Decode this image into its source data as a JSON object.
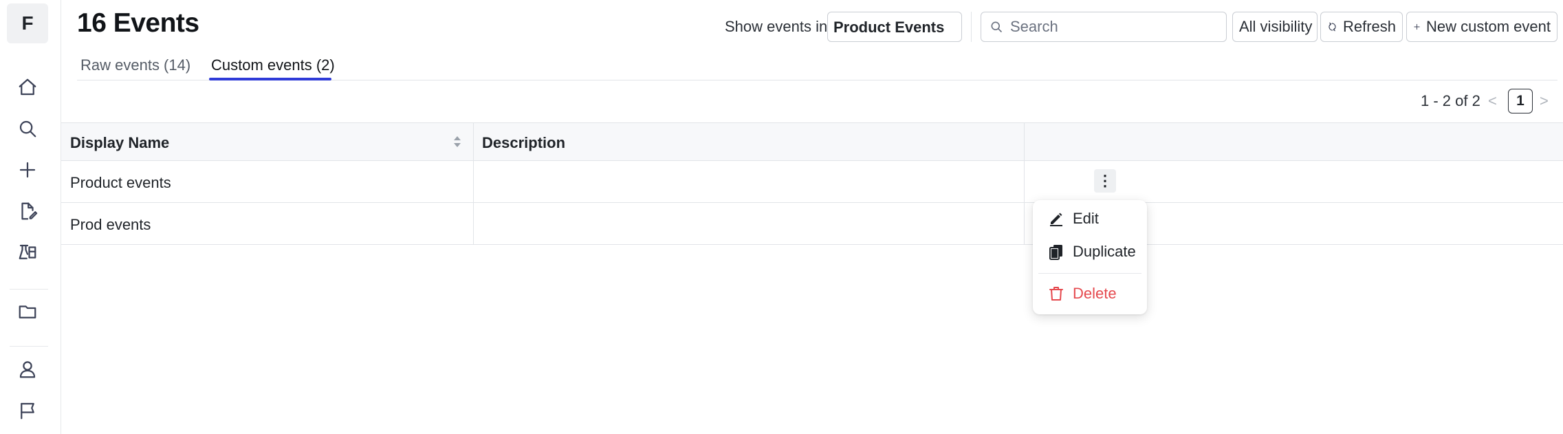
{
  "app": {
    "logo_letter": "F"
  },
  "sidebar": {
    "icons": [
      "home-icon",
      "search-icon",
      "plus-icon",
      "edit-document-icon",
      "lab-flask-icon",
      "folder-icon",
      "user-icon",
      "flag-icon"
    ]
  },
  "header": {
    "title": "16 Events",
    "show_events_label": "Show events in",
    "events_source_value": "Product Events",
    "search_placeholder": "Search",
    "visibility_label": "All visibility",
    "refresh_label": "Refresh",
    "new_event_label": "New custom event"
  },
  "tabs": [
    {
      "label": "Raw events (14)",
      "active": false
    },
    {
      "label": "Custom events (2)",
      "active": true
    }
  ],
  "pagination": {
    "range_text": "1 - 2 of 2",
    "current_page": "1",
    "prev": "<",
    "next": ">"
  },
  "table": {
    "columns": [
      "Display Name",
      "Description",
      ""
    ],
    "rows": [
      {
        "display_name": "Product events",
        "description": ""
      },
      {
        "display_name": "Prod events",
        "description": ""
      }
    ]
  },
  "row_menu": {
    "kebab": "⋮",
    "items": [
      {
        "label": "Edit",
        "icon": "pencil-icon"
      },
      {
        "label": "Duplicate",
        "icon": "duplicate-icon"
      },
      {
        "label": "Delete",
        "icon": "trash-icon"
      }
    ]
  },
  "colors": {
    "accent": "#2f3bd8",
    "danger": "#e5484d"
  }
}
